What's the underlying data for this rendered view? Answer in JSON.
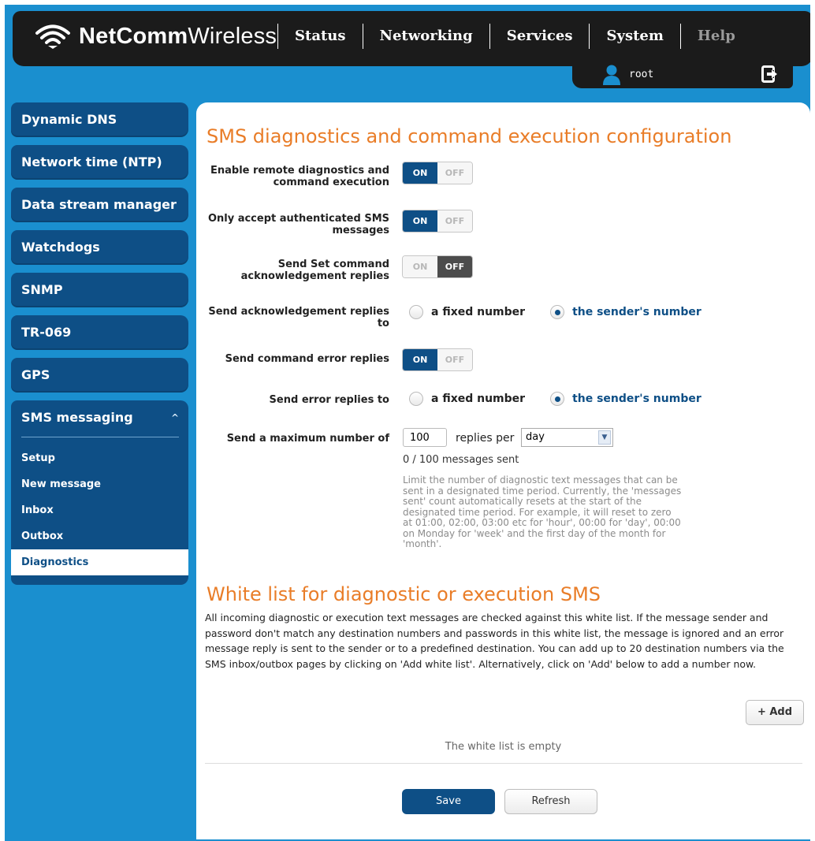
{
  "brand": {
    "bold": "NetComm",
    "light": "Wireless"
  },
  "nav": [
    {
      "label": "Status"
    },
    {
      "label": "Networking"
    },
    {
      "label": "Services"
    },
    {
      "label": "System"
    },
    {
      "label": "Help"
    }
  ],
  "user": {
    "name": "root"
  },
  "sidebar": {
    "items": [
      {
        "label": "Dynamic DNS"
      },
      {
        "label": "Network time (NTP)"
      },
      {
        "label": "Data stream manager"
      },
      {
        "label": "Watchdogs"
      },
      {
        "label": "SNMP"
      },
      {
        "label": "TR-069"
      },
      {
        "label": "GPS"
      }
    ],
    "group": {
      "label": "SMS messaging",
      "chevron": "^",
      "subitems": [
        {
          "label": "Setup"
        },
        {
          "label": "New message"
        },
        {
          "label": "Inbox"
        },
        {
          "label": "Outbox"
        },
        {
          "label": "Diagnostics"
        }
      ],
      "active": "Diagnostics"
    }
  },
  "config": {
    "title": "SMS diagnostics and command execution configuration",
    "toggle_on": "ON",
    "toggle_off": "OFF",
    "enable_remote": {
      "label": "Enable remote diagnostics and command execution",
      "value": "ON"
    },
    "only_auth": {
      "label": "Only accept authenticated SMS messages",
      "value": "ON"
    },
    "send_set_ack": {
      "label": "Send Set command acknowledgement replies",
      "value": "OFF"
    },
    "send_ack_to": {
      "label": "Send acknowledgement replies to",
      "options": [
        "a fixed number",
        "the sender's number"
      ],
      "selected": "the sender's number"
    },
    "send_error": {
      "label": "Send command error replies",
      "value": "ON"
    },
    "send_error_to": {
      "label": "Send error replies to",
      "options": [
        "a fixed number",
        "the sender's number"
      ],
      "selected": "the sender's number"
    },
    "max_number": {
      "label": "Send a maximum number of",
      "value": "100",
      "replies_per": "replies per",
      "period": "day"
    },
    "sent_count": "0 / 100 messages sent",
    "limit_note": "Limit the number of diagnostic text messages that can be sent in a designated time period. Currently, the 'messages sent' count automatically resets at the start of the designated time period. For example, it will reset to zero at 01:00, 02:00, 03:00 etc for 'hour', 00:00 for 'day', 00:00 on Monday for 'week' and the first day of the month for 'month'."
  },
  "whitelist": {
    "title": "White list for diagnostic or execution SMS",
    "description": "All incoming diagnostic or execution text messages are checked against this white list. If the message sender and password don't match any destination numbers and passwords in this white list, the message is ignored and an error message reply is sent to the sender or to a predefined destination. You can add up to 20 destination numbers via the SMS inbox/outbox pages by clicking on 'Add white list'. Alternatively, click on 'Add' below to add a number now.",
    "add_label": "+ Add",
    "empty_text": "The white list is empty"
  },
  "actions": {
    "save": "Save",
    "refresh": "Refresh"
  },
  "colors": {
    "background": "#1a8fcf",
    "primary": "#0e4f86",
    "heading": "#e97d28",
    "topbar": "#1b1b1b"
  },
  "icons": {
    "logo": "wifi-icon",
    "user": "user-icon",
    "logout": "logout-icon"
  }
}
